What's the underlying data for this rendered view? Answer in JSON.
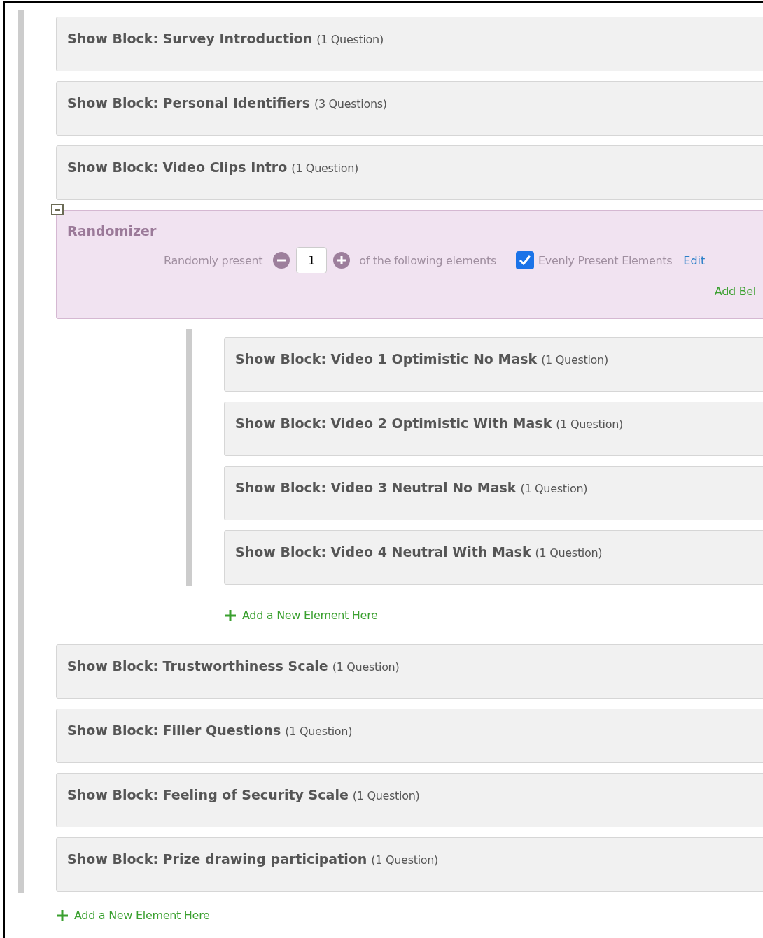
{
  "elements": [
    {
      "kind": "block",
      "label": "Show Block:",
      "title": "Survey Introduction",
      "count": "(1 Question)"
    },
    {
      "kind": "block",
      "label": "Show Block:",
      "title": "Personal Identifiers",
      "count": "(3 Questions)"
    },
    {
      "kind": "block",
      "label": "Show Block:",
      "title": "Video Clips Intro",
      "count": "(1 Question)"
    },
    {
      "kind": "randomizer",
      "expanded": true,
      "title": "Randomizer",
      "present_label": "Randomly present",
      "present_value": "1",
      "following_label": "of the following elements",
      "evenly": {
        "label": "Evenly Present Elements",
        "checked": true
      },
      "edit_link": "Edit",
      "add_below": "Add Bel",
      "children": [
        {
          "kind": "block",
          "label": "Show Block:",
          "title": "Video 1 Optimistic No Mask",
          "count": "(1 Question)"
        },
        {
          "kind": "block",
          "label": "Show Block:",
          "title": "Video 2 Optimistic With Mask",
          "count": "(1 Question)"
        },
        {
          "kind": "block",
          "label": "Show Block:",
          "title": "Video 3 Neutral No Mask",
          "count": "(1 Question)"
        },
        {
          "kind": "block",
          "label": "Show Block:",
          "title": "Video 4 Neutral With Mask",
          "count": "(1 Question)"
        }
      ],
      "add_element": "Add a New Element Here"
    },
    {
      "kind": "block",
      "label": "Show Block:",
      "title": "Trustworthiness Scale",
      "count": "(1 Question)"
    },
    {
      "kind": "block",
      "label": "Show Block:",
      "title": "Filler Questions",
      "count": "(1 Question)"
    },
    {
      "kind": "block",
      "label": "Show Block:",
      "title": "Feeling of Security Scale",
      "count": "(1 Question)"
    },
    {
      "kind": "block",
      "label": "Show Block:",
      "title": "Prize drawing participation",
      "count": "(1 Question)"
    }
  ],
  "add_element": "Add a New Element Here"
}
